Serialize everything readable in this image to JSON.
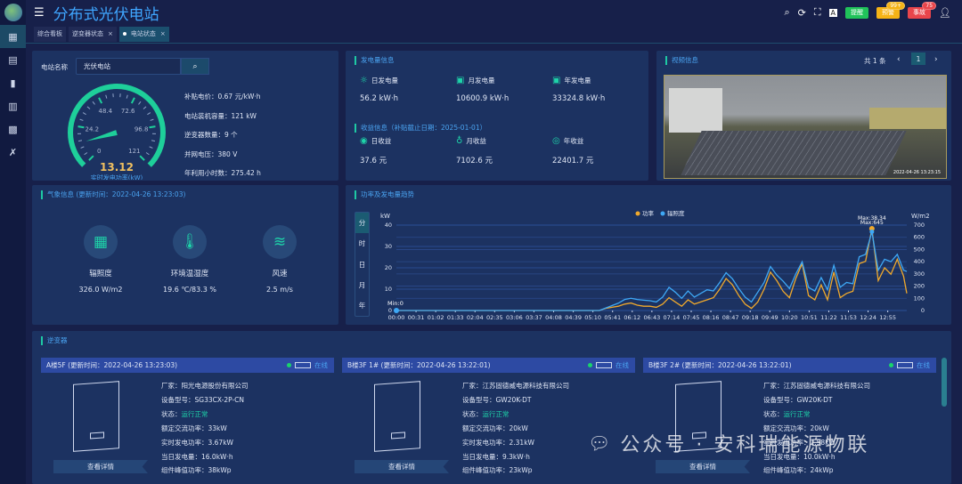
{
  "app": {
    "title": "分布式光伏电站"
  },
  "sidebar": {
    "items": [
      {
        "icon": "grid-icon"
      },
      {
        "icon": "document-icon"
      },
      {
        "icon": "camera-icon"
      },
      {
        "icon": "table-icon"
      },
      {
        "icon": "panel-icon"
      },
      {
        "icon": "tools-icon"
      }
    ]
  },
  "header": {
    "badges": [
      {
        "label": "提醒",
        "color": "#20c35a"
      },
      {
        "label": "预警",
        "color": "#f5b316",
        "count": "99+"
      },
      {
        "label": "事故",
        "color": "#e9454b",
        "count": "75"
      }
    ]
  },
  "tabs": [
    {
      "label": "综合看板"
    },
    {
      "label": "逆变器状态",
      "close": "×"
    },
    {
      "label": "电站状态",
      "close": "×",
      "active": true
    }
  ],
  "station": {
    "name_label": "电站名称",
    "name_value": "光伏电站",
    "gauge": {
      "value": "13.12",
      "label": "实时发电功率(kW)",
      "min": 0,
      "max": 121,
      "ticks": [
        "0",
        "24.2",
        "48.4",
        "72.6",
        "96.8",
        "121"
      ]
    },
    "info": [
      "补贴电价：0.67 元/kW·h",
      "电站装机容量：121 kW",
      "逆变器数量：9 个",
      "并网电压：380 V",
      "年利用小时数：275.42 h"
    ]
  },
  "generation": {
    "title": "发电量信息",
    "items": [
      {
        "label": "日发电量",
        "value": "56.2 kW·h"
      },
      {
        "label": "月发电量",
        "value": "10600.9 kW·h"
      },
      {
        "label": "年发电量",
        "value": "33324.8 kW·h"
      }
    ]
  },
  "income": {
    "title": "收益信息（补贴截止日期：2025-01-01）",
    "items": [
      {
        "label": "日收益",
        "value": "37.6 元"
      },
      {
        "label": "月收益",
        "value": "7102.6 元"
      },
      {
        "label": "年收益",
        "value": "22401.7 元"
      }
    ]
  },
  "video": {
    "title": "视频信息",
    "total": "共 1 条",
    "page": "1",
    "prev": "‹",
    "next": "›",
    "camera_timestamp": "2022-04-26 13:23:15"
  },
  "weather": {
    "title": "气象信息 (更新时间：2022-04-26 13:23:03)",
    "items": [
      {
        "label": "辐照度",
        "value": "326.0 W/m2"
      },
      {
        "label": "环境温湿度",
        "value": "19.6 ℃/83.3 %"
      },
      {
        "label": "风速",
        "value": "2.5 m/s"
      }
    ]
  },
  "trend": {
    "title": "功率及发电量趋势",
    "periods": [
      "分",
      "时",
      "日",
      "月",
      "年"
    ],
    "active_period": "分"
  },
  "chart_data": {
    "type": "line",
    "ylabel_left": "kW",
    "ylabel_right": "W/m2",
    "ylim_left": [
      0,
      40
    ],
    "ylim_right": [
      0,
      700
    ],
    "yticks_left": [
      "0",
      "10",
      "20",
      "30",
      "40"
    ],
    "yticks_right": [
      "0",
      "100",
      "200",
      "300",
      "400",
      "500",
      "600",
      "700"
    ],
    "xticks": [
      "00:00",
      "00:31",
      "01:02",
      "01:33",
      "02:04",
      "02:35",
      "03:06",
      "03:37",
      "04:08",
      "04:39",
      "05:10",
      "05:41",
      "06:12",
      "06:43",
      "07:14",
      "07:45",
      "08:16",
      "08:47",
      "09:18",
      "09:49",
      "10:20",
      "10:51",
      "11:22",
      "11:53",
      "12:24",
      "12:55"
    ],
    "legend": "top-right",
    "grid": true,
    "annotations": {
      "min": "Min:0",
      "max_power": "Max:38.34",
      "max_irradiance": "Max:645"
    },
    "series": [
      {
        "name": "功率",
        "color": "#f0a92c",
        "axis": "left"
      },
      {
        "name": "辐照度",
        "color": "#3ea8f5",
        "axis": "right"
      }
    ],
    "x": [
      "00:00",
      "05:20",
      "05:30",
      "05:40",
      "05:50",
      "06:00",
      "06:10",
      "06:20",
      "06:30",
      "06:40",
      "06:50",
      "07:00",
      "07:10",
      "07:20",
      "07:30",
      "07:40",
      "07:50",
      "08:00",
      "08:10",
      "08:20",
      "08:30",
      "08:40",
      "08:50",
      "09:00",
      "09:10",
      "09:20",
      "09:30",
      "09:40",
      "09:50",
      "10:00",
      "10:10",
      "10:20",
      "10:30",
      "10:40",
      "10:50",
      "11:00",
      "11:10",
      "11:20",
      "11:30",
      "11:40",
      "11:50",
      "12:00",
      "12:10",
      "12:20",
      "12:30",
      "12:40",
      "12:50",
      "13:00",
      "13:10",
      "13:20",
      "13:25"
    ],
    "power": [
      0,
      0,
      1,
      1.5,
      2,
      3,
      3.5,
      2.5,
      2,
      2,
      1.5,
      3,
      6,
      4,
      2,
      5,
      3,
      4,
      5,
      6,
      10,
      15,
      12,
      7,
      3,
      1,
      4,
      10,
      18,
      14,
      9,
      6,
      15,
      22,
      7,
      5,
      12,
      5,
      18,
      6,
      8,
      9,
      22,
      23,
      38.34,
      14,
      20,
      17,
      24,
      16,
      8
    ],
    "irradiance": [
      0,
      0,
      20,
      40,
      60,
      90,
      100,
      90,
      85,
      80,
      70,
      110,
      190,
      150,
      100,
      160,
      110,
      140,
      170,
      160,
      230,
      310,
      260,
      180,
      110,
      70,
      150,
      230,
      360,
      290,
      240,
      180,
      300,
      400,
      190,
      160,
      270,
      170,
      370,
      190,
      230,
      220,
      440,
      460,
      645,
      330,
      420,
      400,
      460,
      330,
      320
    ]
  },
  "inverters": {
    "title": "逆变器",
    "status_online": "在线",
    "detail_label": "查看详情",
    "cards": [
      {
        "name": "A楼5F (更新时间：2022-04-26 13:23:03)",
        "lines": [
          "厂家：阳光电源股份有限公司",
          "设备型号：SG33CX-2P-CN"
        ],
        "status_label": "状态：",
        "status": "运行正常",
        "lines2": [
          "额定交流功率：33kW",
          "实时发电功率：3.67kW",
          "当日发电量：16.0kW·h",
          "组件峰值功率：38kWp"
        ]
      },
      {
        "name": "B楼3F 1# (更新时间：2022-04-26 13:22:01)",
        "lines": [
          "厂家：江苏固德威电源科技有限公司",
          "设备型号：GW20K-DT"
        ],
        "status_label": "状态：",
        "status": "运行正常",
        "lines2": [
          "额定交流功率：20kW",
          "实时发电功率：2.31kW",
          "当日发电量：9.3kW·h",
          "组件峰值功率：23kWp"
        ]
      },
      {
        "name": "B楼3F 2# (更新时间：2022-04-26 13:22:01)",
        "lines": [
          "厂家：江苏固德威电源科技有限公司",
          "设备型号：GW20K-DT"
        ],
        "status_label": "状态：",
        "status": "运行正常",
        "lines2": [
          "额定交流功率：20kW",
          "实时发电功率：2.58kW",
          "当日发电量：10.0kW·h",
          "组件峰值功率：24kWp"
        ]
      }
    ]
  },
  "watermark": "公众号 · 安科瑞能源物联"
}
